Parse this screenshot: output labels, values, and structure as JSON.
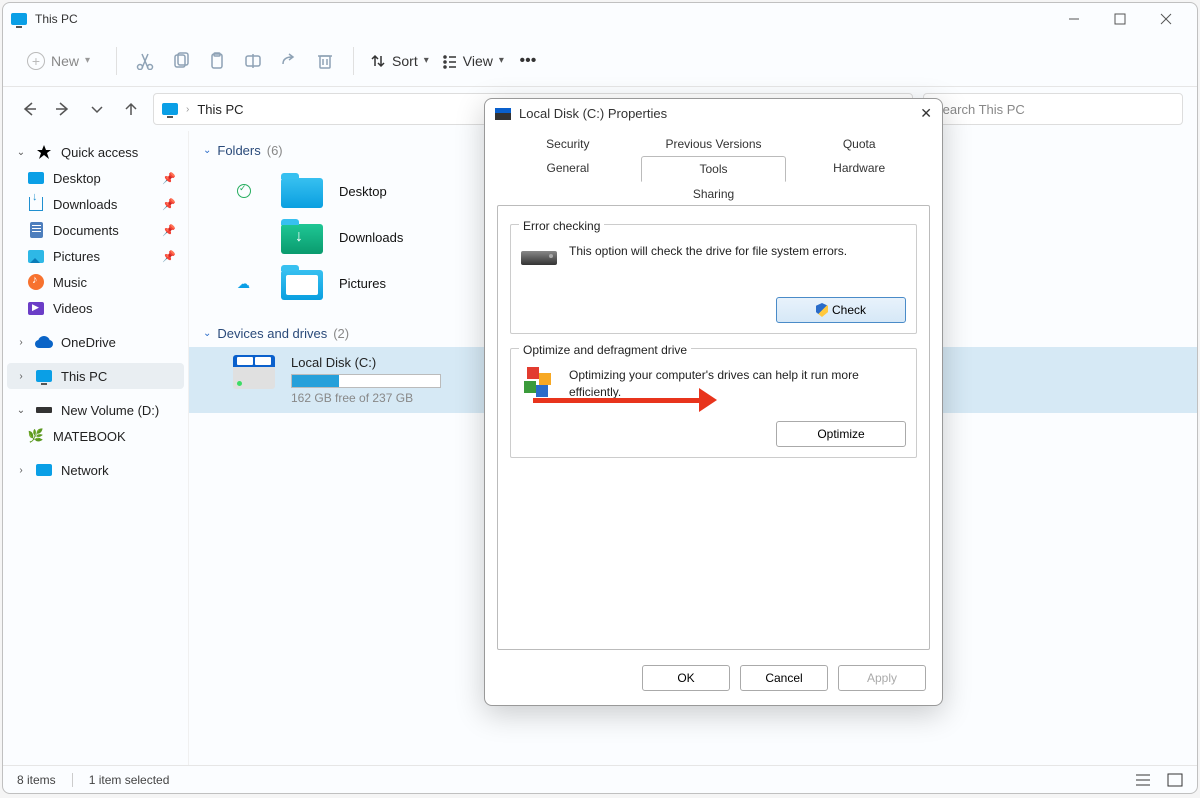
{
  "window": {
    "title": "This PC"
  },
  "toolbar": {
    "new": "New",
    "sort": "Sort",
    "view": "View"
  },
  "breadcrumb": {
    "loc": "This PC"
  },
  "search": {
    "placeholder": "Search This PC"
  },
  "sidebar": {
    "quick": "Quick access",
    "desktop": "Desktop",
    "downloads": "Downloads",
    "documents": "Documents",
    "pictures": "Pictures",
    "music": "Music",
    "videos": "Videos",
    "onedrive": "OneDrive",
    "thispc": "This PC",
    "newvol": "New Volume (D:)",
    "matebook": "MATEBOOK",
    "network": "Network"
  },
  "sections": {
    "folders": {
      "title": "Folders",
      "count": "(6)"
    },
    "drives": {
      "title": "Devices and drives",
      "count": "(2)"
    }
  },
  "folders": {
    "desktop": "Desktop",
    "downloads": "Downloads",
    "pictures": "Pictures"
  },
  "drive": {
    "name": "Local Disk (C:)",
    "free": "162 GB free of 237 GB",
    "fillpercent": 32
  },
  "status": {
    "items": "8 items",
    "selected": "1 item selected"
  },
  "dialog": {
    "title": "Local Disk (C:) Properties",
    "tabs": {
      "security": "Security",
      "prev": "Previous Versions",
      "quota": "Quota",
      "general": "General",
      "tools": "Tools",
      "hardware": "Hardware",
      "sharing": "Sharing"
    },
    "errcheck": {
      "title": "Error checking",
      "desc": "This option will check the drive for file system errors.",
      "btn": "Check"
    },
    "optimize": {
      "title": "Optimize and defragment drive",
      "desc": "Optimizing your computer's drives can help it run more efficiently.",
      "btn": "Optimize"
    },
    "btns": {
      "ok": "OK",
      "cancel": "Cancel",
      "apply": "Apply"
    }
  }
}
